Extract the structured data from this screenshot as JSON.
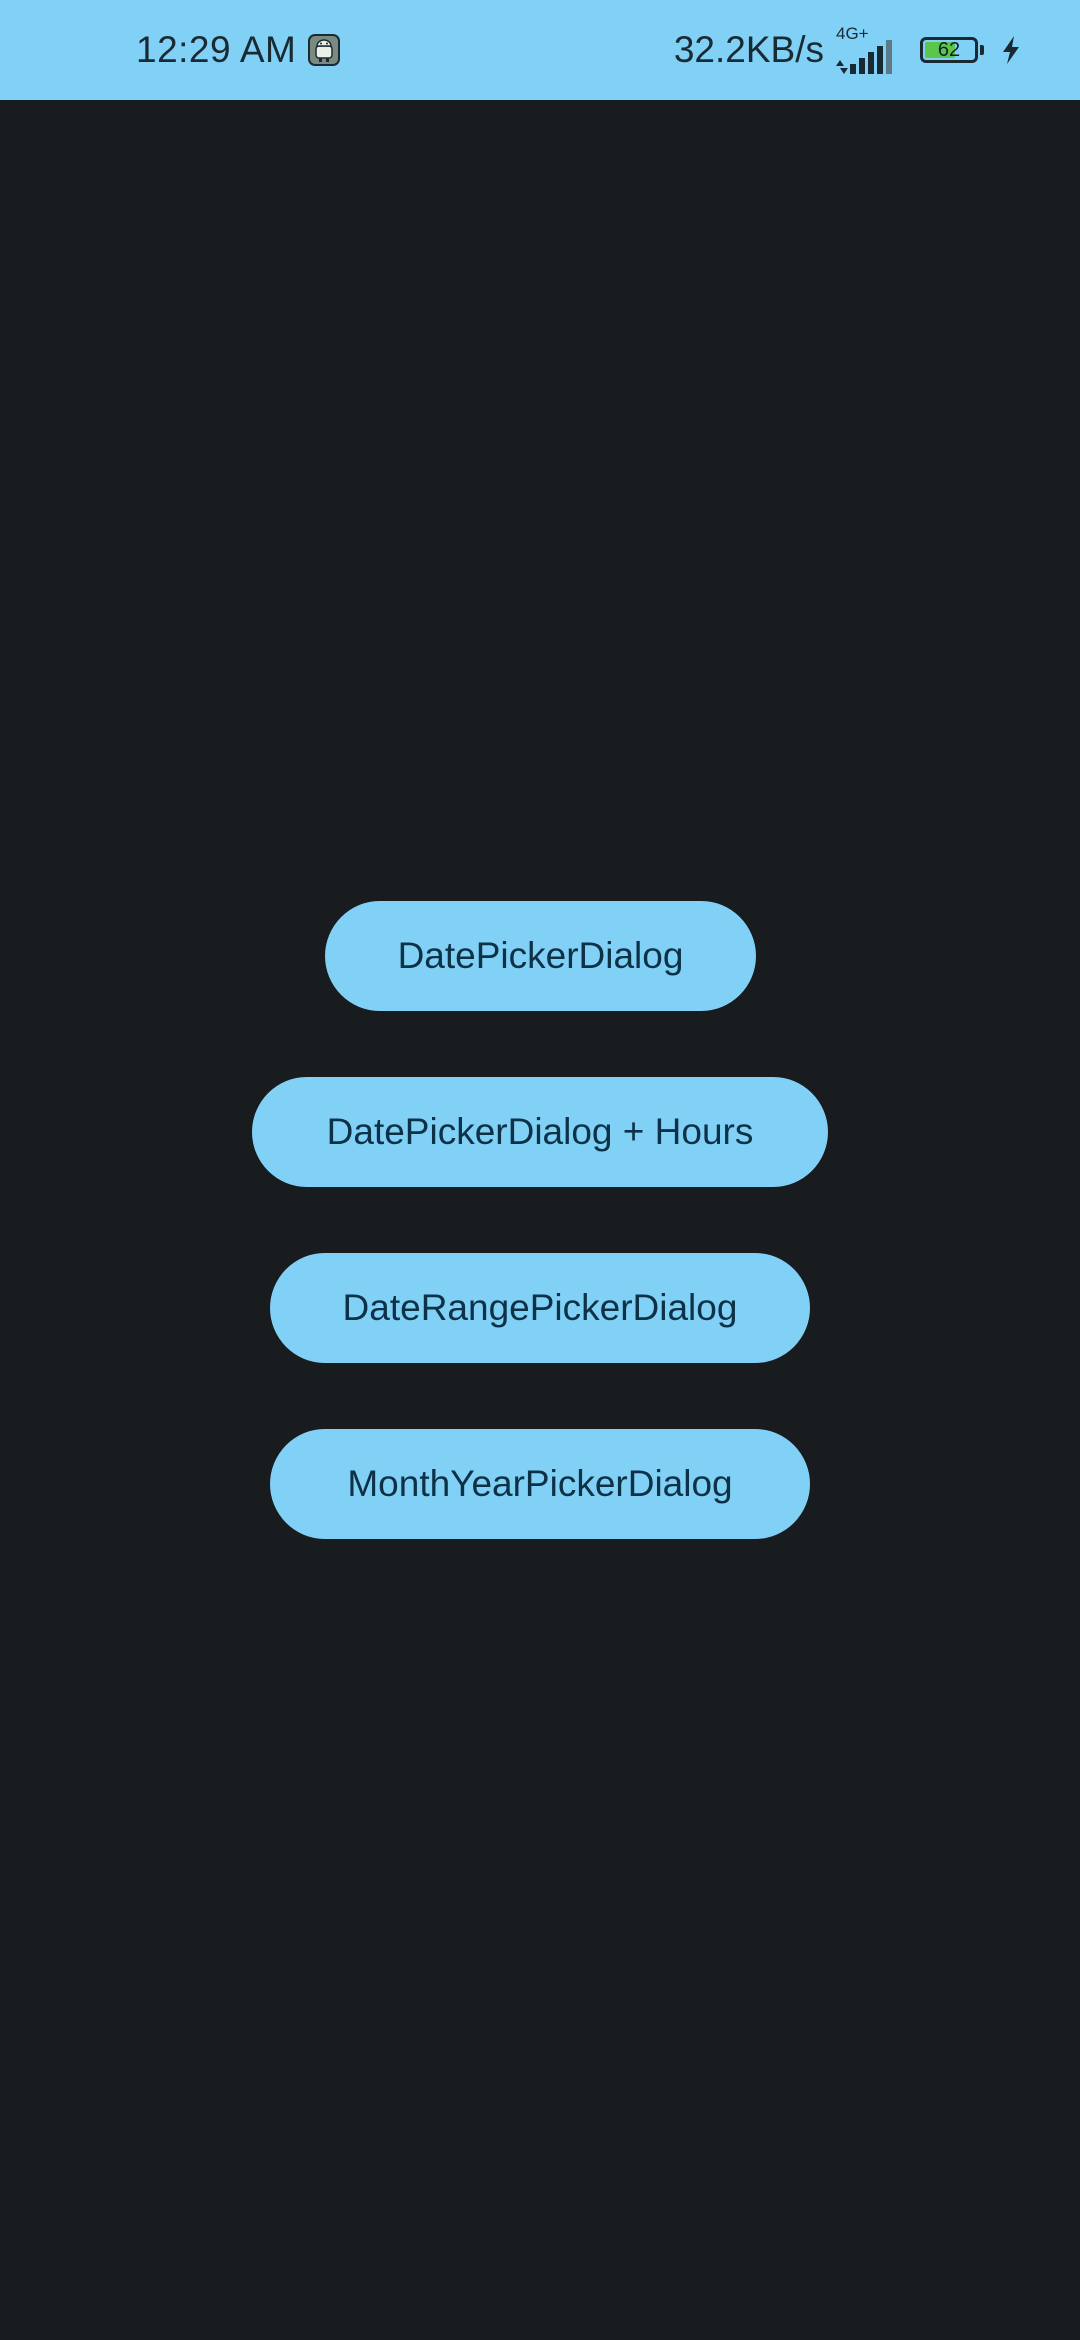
{
  "status_bar": {
    "time": "12:29 AM",
    "notification_icon": "android-robot-icon",
    "network_speed": "32.2KB/s",
    "network_type": "4G+",
    "signal_icon": "cell-signal-icon",
    "battery_level": 62,
    "battery_text": "62",
    "charging_icon": "lightning-bolt-icon",
    "colors": {
      "bar_background": "#81d1f7",
      "text": "#1a2a33",
      "battery_fill": "#5cc64a"
    }
  },
  "main": {
    "background_color": "#191c1f",
    "buttons": [
      {
        "label": "DatePickerDialog"
      },
      {
        "label": "DatePickerDialog + Hours"
      },
      {
        "label": "DateRangePickerDialog"
      },
      {
        "label": "MonthYearPickerDialog"
      }
    ],
    "button_color": "#81d1f7",
    "button_text_color": "#0d3146"
  }
}
